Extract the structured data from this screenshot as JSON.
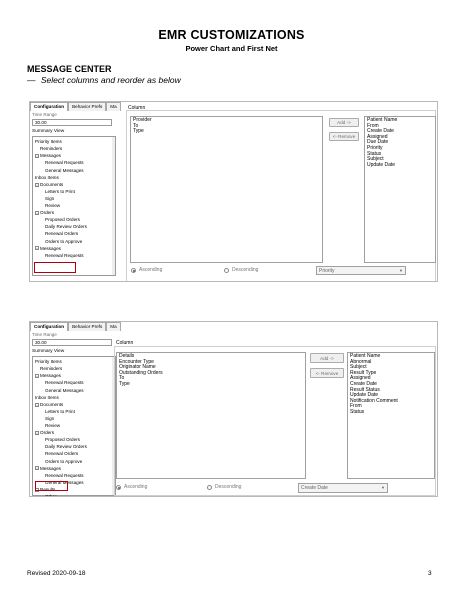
{
  "doc": {
    "title": "EMR CUSTOMIZATIONS",
    "subtitle": "Power Chart and First Net",
    "section_heading": "MESSAGE CENTER",
    "instruction_dash": "—",
    "instruction": "Select columns and reorder as below"
  },
  "shot1": {
    "tabs": [
      "Configuration",
      "Behavior Prefs",
      "Ma"
    ],
    "time_range_label": "Time Range",
    "time_range_value": "30.00",
    "summary_view_label": "Summary View",
    "tree": [
      {
        "label": "Priority Items",
        "indent": 0,
        "exp": ""
      },
      {
        "label": "Reminders",
        "indent": 1,
        "exp": ""
      },
      {
        "label": "Messages",
        "indent": 0,
        "exp": "−"
      },
      {
        "label": "Renewal Requests",
        "indent": 2,
        "exp": ""
      },
      {
        "label": "General Messages",
        "indent": 2,
        "exp": ""
      },
      {
        "label": "Inbox Items",
        "indent": 0,
        "exp": ""
      },
      {
        "label": "Documents",
        "indent": 0,
        "exp": "−"
      },
      {
        "label": "Letters to Print",
        "indent": 2,
        "exp": ""
      },
      {
        "label": "Sign",
        "indent": 2,
        "exp": ""
      },
      {
        "label": "Review",
        "indent": 2,
        "exp": ""
      },
      {
        "label": "Orders",
        "indent": 0,
        "exp": "−"
      },
      {
        "label": "Proposed Orders",
        "indent": 2,
        "exp": ""
      },
      {
        "label": "Daily Review Orders",
        "indent": 2,
        "exp": ""
      },
      {
        "label": "Renewal Orders",
        "indent": 2,
        "exp": ""
      },
      {
        "label": "Orders to Approve",
        "indent": 2,
        "exp": ""
      },
      {
        "label": "Messages",
        "indent": 0,
        "exp": "−"
      },
      {
        "label": "Renewal Requests",
        "indent": 2,
        "exp": ""
      }
    ],
    "column_label": "Column",
    "available_columns": [
      "Provider",
      "To",
      "Type"
    ],
    "selected_columns": [
      "Patient Name",
      "From",
      "Create Date",
      "Assigned",
      "Due Date",
      "Priority",
      "Status",
      "Subject",
      "Update Date"
    ],
    "add_label": "Add ->",
    "remove_label": "<- Remove",
    "ascending_label": "Ascending",
    "descending_label": "Descending",
    "sort_value": "Priority"
  },
  "shot2": {
    "tabs": [
      "Configuration",
      "Behavior Prefs",
      "Ma"
    ],
    "time_range_label": "Time Range",
    "time_range_value": "30.00",
    "summary_view_label": "Summary View",
    "tree": [
      {
        "label": "Priority Items",
        "indent": 0,
        "exp": ""
      },
      {
        "label": "Reminders",
        "indent": 1,
        "exp": ""
      },
      {
        "label": "Messages",
        "indent": 0,
        "exp": "−"
      },
      {
        "label": "Renewal Requests",
        "indent": 2,
        "exp": ""
      },
      {
        "label": "General Messages",
        "indent": 2,
        "exp": ""
      },
      {
        "label": "Inbox Items",
        "indent": 0,
        "exp": ""
      },
      {
        "label": "Documents",
        "indent": 0,
        "exp": "−"
      },
      {
        "label": "Letters to Print",
        "indent": 2,
        "exp": ""
      },
      {
        "label": "Sign",
        "indent": 2,
        "exp": ""
      },
      {
        "label": "Review",
        "indent": 2,
        "exp": ""
      },
      {
        "label": "Orders",
        "indent": 0,
        "exp": "−"
      },
      {
        "label": "Proposed Orders",
        "indent": 2,
        "exp": ""
      },
      {
        "label": "Daily Review Orders",
        "indent": 2,
        "exp": ""
      },
      {
        "label": "Renewal Orders",
        "indent": 2,
        "exp": ""
      },
      {
        "label": "Orders to Approve",
        "indent": 2,
        "exp": ""
      },
      {
        "label": "Messages",
        "indent": 0,
        "exp": "−"
      },
      {
        "label": "Renewal Requests",
        "indent": 2,
        "exp": ""
      },
      {
        "label": "General Messages",
        "indent": 2,
        "exp": ""
      },
      {
        "label": "Results",
        "indent": 0,
        "exp": "−"
      },
      {
        "label": "Other",
        "indent": 2,
        "exp": ""
      }
    ],
    "column_label": "Column",
    "available_columns": [
      "Details",
      "Encounter Type",
      "Originator Name",
      "Outstanding Orders",
      "To",
      "Type"
    ],
    "selected_columns": [
      "Patient Name",
      "Abnormal",
      "Subject",
      "Result Type",
      "Assigned",
      "Create Date",
      "Result Status",
      "Update Date",
      "Notification Comment",
      "From",
      "Status"
    ],
    "add_label": "Add ->",
    "remove_label": "<- Remove",
    "ascending_label": "Ascending",
    "descending_label": "Descending",
    "sort_value": "Create Date"
  },
  "footer": {
    "revised": "Revised 2020-09-18",
    "page_number": "3"
  }
}
